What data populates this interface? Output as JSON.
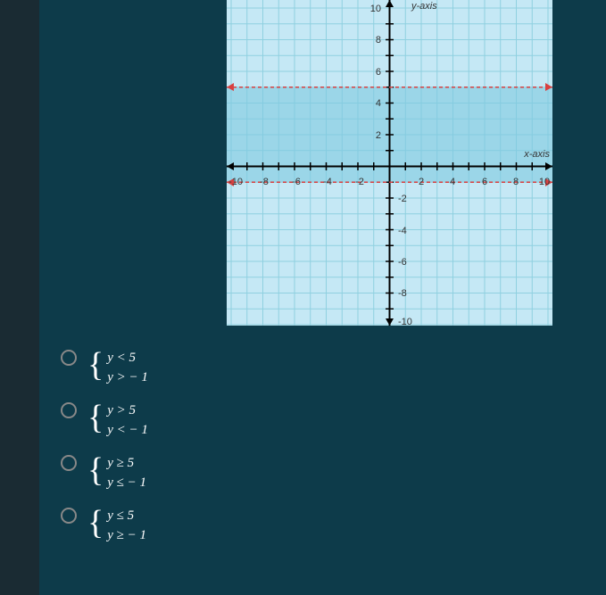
{
  "chart_data": {
    "type": "inequality_graph",
    "x_range": [
      -10,
      10
    ],
    "y_range": [
      -10,
      10
    ],
    "x_ticks": [
      -10,
      -8,
      -6,
      -4,
      -2,
      2,
      4,
      6,
      8,
      10
    ],
    "y_ticks": [
      -10,
      -8,
      -6,
      -4,
      -2,
      2,
      4,
      6,
      8,
      10
    ],
    "xlabel": "x-axis",
    "ylabel": "y-axis",
    "shaded_region": {
      "y_min": -1,
      "y_max": 5
    },
    "boundary_lines": [
      {
        "y": 5,
        "style": "dashed",
        "color": "red"
      },
      {
        "y": -1,
        "style": "dashed",
        "color": "red"
      }
    ]
  },
  "options": [
    {
      "line1": "y < 5",
      "line2": "y > − 1"
    },
    {
      "line1": "y > 5",
      "line2": "y < − 1"
    },
    {
      "line1": "y ≥ 5",
      "line2": "y ≤ − 1"
    },
    {
      "line1": "y ≤ 5",
      "line2": "y ≥ − 1"
    }
  ]
}
